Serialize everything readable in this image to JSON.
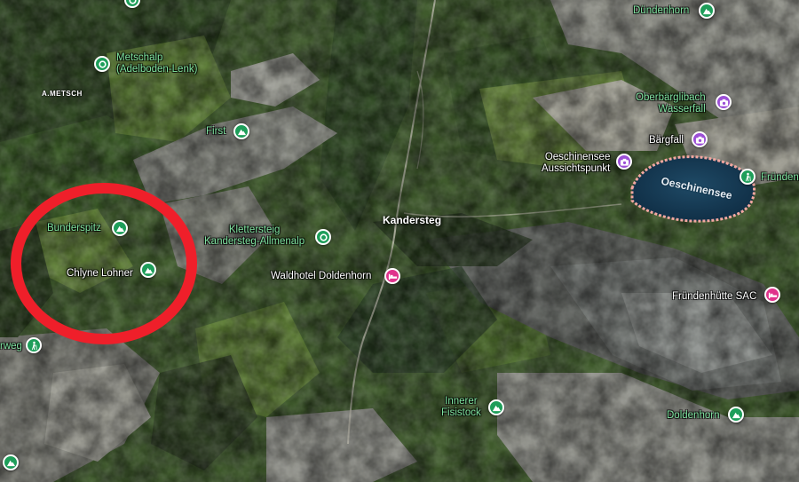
{
  "map": {
    "town": "Kandersteg",
    "place": "A.METSCH",
    "lake": "Oeschinensee",
    "highlight_color": "#ef1f2a",
    "markers": [
      {
        "id": "dundenhorn",
        "text": "Dündenhorn",
        "icon": "mountain-icon",
        "color": "#1e9e5a"
      },
      {
        "id": "metschalp",
        "text": "Metschalp\n(Adelboden-Lenk)",
        "icon": "station-icon",
        "color": "#1e9e5a"
      },
      {
        "id": "first",
        "text": "First",
        "icon": "mountain-icon",
        "color": "#1e9e5a"
      },
      {
        "id": "oberbarglibach",
        "text": "Oberbärglibach\nWasserfall",
        "icon": "camera-icon",
        "color": "#9c4fd6"
      },
      {
        "id": "barfall",
        "text": "Bärgfall",
        "icon": "camera-icon",
        "color": "#9c4fd6"
      },
      {
        "id": "aussichtspunkt",
        "text": "Oeschinensee\nAussichtspunkt",
        "icon": "camera-icon",
        "color": "#9c4fd6"
      },
      {
        "id": "frunden",
        "text": "Fründen",
        "icon": "hiker-icon",
        "color": "#1e9e5a"
      },
      {
        "id": "bunderspitz",
        "text": "Bunderspitz",
        "icon": "mountain-icon",
        "color": "#1e9e5a"
      },
      {
        "id": "klettersteig",
        "text": "Klettersteig\nKandersteg-Allmenalp",
        "icon": "station-icon",
        "color": "#1e9e5a"
      },
      {
        "id": "chlyne-lohner",
        "text": "Chlyne Lohner",
        "icon": "mountain-icon",
        "color": "#1e9e5a"
      },
      {
        "id": "waldhotel",
        "text": "Waldhotel Doldenhorn",
        "icon": "bed-icon",
        "color": "#e0338c"
      },
      {
        "id": "frundenhutte",
        "text": "Fründenhütte SAC",
        "icon": "bed-icon",
        "color": "#e0338c"
      },
      {
        "id": "rweg",
        "text": "rweg",
        "icon": "hiker-icon",
        "color": "#1e9e5a"
      },
      {
        "id": "innerer-fisistock",
        "text": "Innerer\nFisistock",
        "icon": "mountain-icon",
        "color": "#1e9e5a"
      },
      {
        "id": "doldenhorn",
        "text": "Doldenhorn",
        "icon": "mountain-icon",
        "color": "#1e9e5a"
      },
      {
        "id": "sw-peak",
        "text": "",
        "icon": "mountain-icon",
        "color": "#1e9e5a"
      },
      {
        "id": "top-edge",
        "text": "",
        "icon": "station-icon",
        "color": "#1e9e5a"
      }
    ]
  }
}
